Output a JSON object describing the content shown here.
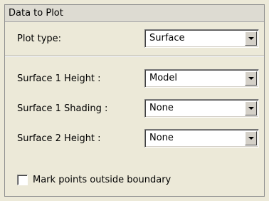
{
  "panel": {
    "title": "Data to Plot",
    "plot_type": {
      "label": "Plot type:",
      "value": "Surface"
    },
    "surface1_height": {
      "label": "Surface 1 Height :",
      "value": "Model"
    },
    "surface1_shading": {
      "label": "Surface 1 Shading :",
      "value": "None"
    },
    "surface2_height": {
      "label": "Surface 2 Height :",
      "value": "None"
    },
    "mark_points": {
      "label": "Mark points outside boundary",
      "checked": false
    }
  },
  "icons": {
    "dropdown_arrow": "chevron-down-icon",
    "checkbox": "checkbox-icon"
  },
  "colors": {
    "background": "#ece9d8",
    "header": "#dddbd2",
    "field": "#ffffff"
  }
}
